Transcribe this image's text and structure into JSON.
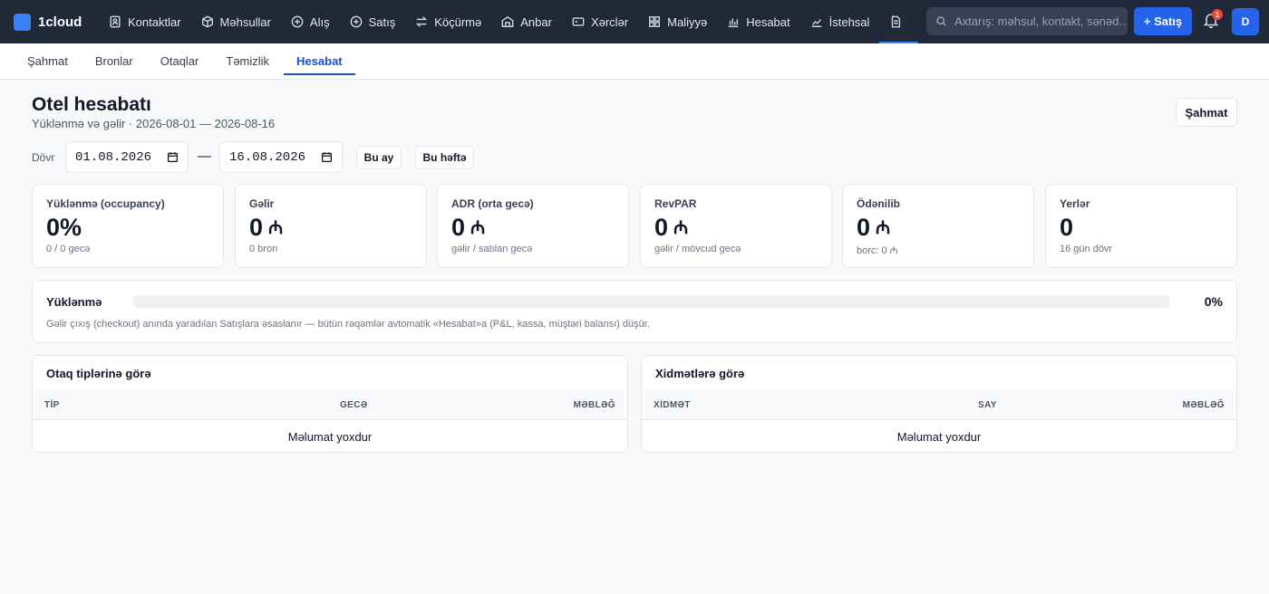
{
  "app": {
    "name": "1cloud"
  },
  "nav": [
    {
      "label": "Kontaktlar",
      "icon": "contacts-icon"
    },
    {
      "label": "Məhsullar",
      "icon": "box-icon"
    },
    {
      "label": "Alış",
      "icon": "plus-circle-icon"
    },
    {
      "label": "Satış",
      "icon": "plus-circle-icon"
    },
    {
      "label": "Köçürmə",
      "icon": "transfer-icon"
    },
    {
      "label": "Anbar",
      "icon": "warehouse-icon"
    },
    {
      "label": "Xərclər",
      "icon": "wallet-icon"
    },
    {
      "label": "Maliyyə",
      "icon": "grid-icon"
    },
    {
      "label": "Hesabat",
      "icon": "bar-chart-icon"
    },
    {
      "label": "İstehsal",
      "icon": "factory-icon"
    },
    {
      "label": "",
      "icon": "document-icon"
    }
  ],
  "search": {
    "placeholder": "Axtarış: məhsul, kontakt, sənəd..."
  },
  "header_actions": {
    "sale_label": "+ Satış",
    "notifications_count": "1",
    "avatar_letter": "D"
  },
  "subtabs": [
    "Şahmat",
    "Bronlar",
    "Otaqlar",
    "Təmizlik",
    "Hesabat"
  ],
  "active_subtab": "Hesabat",
  "page": {
    "title": "Otel hesabatı",
    "subtitle": "Yüklənmə və gəlir · 2026-08-01 — 2026-08-16",
    "chess_button": "Şahmat"
  },
  "period": {
    "label": "Dövr",
    "from": "01.08.2026",
    "separator": "—",
    "to": "16.08.2026",
    "this_month": "Bu ay",
    "this_week": "Bu həftə"
  },
  "currency_symbol": "₼",
  "kpis": [
    {
      "label": "Yüklənmə (occupancy)",
      "value": "0%",
      "currency": "",
      "sub": "0 / 0 gecə"
    },
    {
      "label": "Gəlir",
      "value": "0",
      "currency": "₼",
      "sub": "0 bron"
    },
    {
      "label": "ADR (orta gecə)",
      "value": "0",
      "currency": "₼",
      "sub": "gəlir / satılan gecə"
    },
    {
      "label": "RevPAR",
      "value": "0",
      "currency": "₼",
      "sub": "gəlir / mövcud gecə"
    },
    {
      "label": "Ödənilib",
      "value": "0",
      "currency": "₼",
      "sub": "borc: 0 ₼"
    },
    {
      "label": "Yerlər",
      "value": "0",
      "currency": "",
      "sub": "16 gün dövr"
    }
  ],
  "occupancy": {
    "label": "Yüklənmə",
    "percent_text": "0%",
    "fill_fraction": 0,
    "note": "Gəlir çıxış (checkout) anında yaradılan Satışlara əsaslanır — bütün rəqəmlər avtomatik «Hesabat»a (P&L, kassa, müştəri balansı) düşür."
  },
  "room_types_table": {
    "title": "Otaq tiplərinə görə",
    "columns": [
      "TİP",
      "GECƏ",
      "MƏBLƏĞ"
    ],
    "empty": "Məlumat yoxdur"
  },
  "services_table": {
    "title": "Xidmətlərə görə",
    "columns": [
      "XİDMƏT",
      "SAY",
      "MƏBLƏĞ"
    ],
    "empty": "Məlumat yoxdur"
  },
  "colors": {
    "topbar": "#1f2937",
    "accent": "#2563eb",
    "badge": "#ef4444"
  }
}
